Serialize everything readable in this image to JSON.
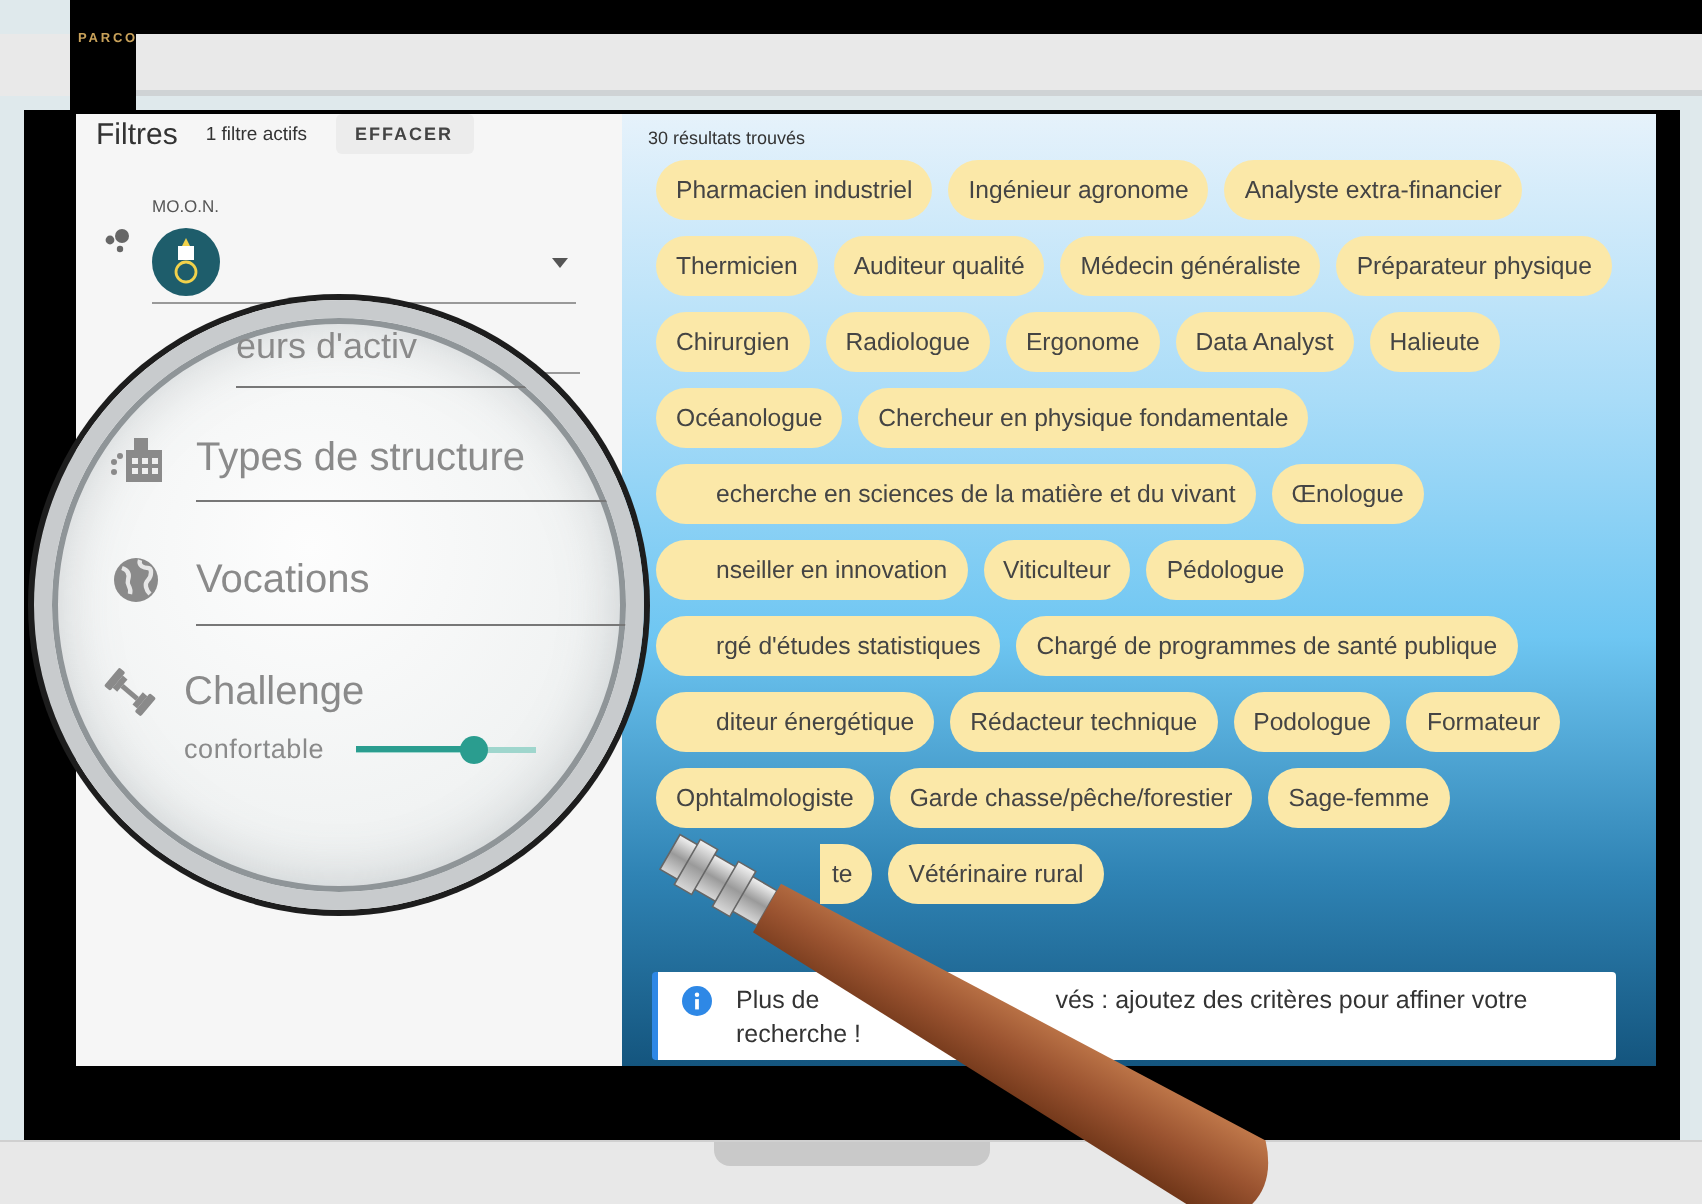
{
  "header": {
    "logo": "PARCO"
  },
  "sidebar": {
    "title": "Filtres",
    "active_count": "1 filtre actifs",
    "clear_button": "EFFACER",
    "field": {
      "label": "MO.O.N."
    }
  },
  "magnifier": {
    "items": [
      {
        "kind": "cut",
        "label": "eurs d'activ"
      },
      {
        "kind": "select",
        "label": "Types de structure"
      },
      {
        "kind": "select",
        "label": "Vocations"
      },
      {
        "kind": "slider",
        "label": "Challenge",
        "value_label": "confortable",
        "level": 0.65
      }
    ]
  },
  "results": {
    "count": "30 résultats trouvés",
    "tags": [
      {
        "label": "Pharmacien industriel",
        "kind": "full"
      },
      {
        "label": "Ingénieur agronome",
        "kind": "full"
      },
      {
        "label": "Analyste extra-financier",
        "kind": "full"
      },
      {
        "label": "Thermicien",
        "kind": "full"
      },
      {
        "label": "Auditeur qualité",
        "kind": "full"
      },
      {
        "label": "Médecin généraliste",
        "kind": "full"
      },
      {
        "label": "Préparateur physique",
        "kind": "full"
      },
      {
        "label": "Chirurgien",
        "kind": "full"
      },
      {
        "label": "Radiologue",
        "kind": "full"
      },
      {
        "label": "Ergonome",
        "kind": "full"
      },
      {
        "label": "Data Analyst",
        "kind": "full"
      },
      {
        "label": "Halieute",
        "kind": "full"
      },
      {
        "label": "Océanologue",
        "kind": "full"
      },
      {
        "label": "Chercheur en physique fondamentale",
        "kind": "full"
      },
      {
        "label": "echerche en sciences de la matière et du vivant",
        "kind": "cut"
      },
      {
        "label": "Œnologue",
        "kind": "full"
      },
      {
        "label": "nseiller en innovation",
        "kind": "cut"
      },
      {
        "label": "Viticulteur",
        "kind": "full"
      },
      {
        "label": "Pédologue",
        "kind": "full"
      },
      {
        "label": "rgé d'études statistiques",
        "kind": "cut"
      },
      {
        "label": "Chargé de programmes de santé publique",
        "kind": "full"
      },
      {
        "label": "diteur énergétique",
        "kind": "cut"
      },
      {
        "label": "Rédacteur technique",
        "kind": "full"
      },
      {
        "label": "Podologue",
        "kind": "full"
      },
      {
        "label": "Formateur",
        "kind": "full"
      },
      {
        "label": "Ophtalmologiste",
        "kind": "full"
      },
      {
        "label": "Garde chasse/pêche/forestier",
        "kind": "full"
      },
      {
        "label": "Sage-femme",
        "kind": "full"
      },
      {
        "label": "te",
        "kind": "covered"
      },
      {
        "label": "Vétérinaire rural",
        "kind": "full"
      }
    ],
    "notice": {
      "parts": [
        "Plus de",
        "vés : ajoutez des critères pour affiner votre",
        "recherche !"
      ]
    }
  }
}
